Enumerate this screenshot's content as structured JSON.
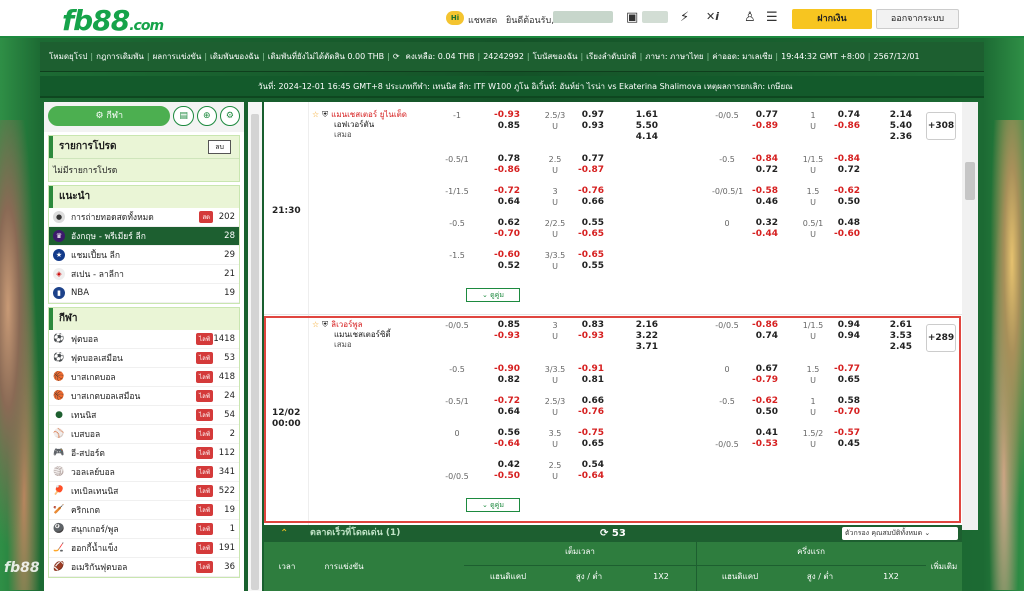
{
  "brand": {
    "name": "fb88",
    "suffix": ".com"
  },
  "topbar": {
    "hi_badge": "Hi",
    "chat": "แชทสด",
    "welcome": "ยินดีต้อนรับ,",
    "deposit": "ฝากเงิน",
    "logout": "ออกจากระบบ",
    "icons": [
      "wallet-icon",
      "flash-icon",
      "sports-x-icon",
      "person-icon",
      "list-icon"
    ]
  },
  "nav": {
    "items": [
      "โหมดยุโรป",
      "กฎการเดิมพัน",
      "ผลการแข่งขัน",
      "เดิมพันของฉัน",
      "เดิมพันที่ยังไม่ได้ตัดสิน 0.00 THB",
      "คงเหลือ: 0.04 THB",
      "24242992",
      "โบนัสของฉัน",
      "เรียงลำดับปกติ",
      "ภาษา: ภาษาไทย",
      "ค่าออด: มาเลเซีย",
      "19:44:32 GMT +8:00",
      "2567/12/01"
    ]
  },
  "ticker": "วันที่: 2024-12-01 16:45 GMT+8 ประเภทกีฬา: เทนนิส ลีก: ITF W100 ภูโน อิเวิ้นท์: อันห์ย่า ไรน่า vs Ekaterina Shalimova เหตุผลการยกเลิก: เกษียณ",
  "sidebar": {
    "sport_button": "กีฬา",
    "fav_title": "รายการโปรด",
    "fav_small": "ลบ",
    "fav_empty": "ไม่มีรายการโปรด",
    "rec_title": "แนะนำ",
    "rec_items": [
      {
        "label": "การถ่ายทอดสดทั้งหมด",
        "count": "202",
        "live": "สด"
      },
      {
        "label": "อังกฤษ - พรีเมียร์ ลีก",
        "count": "28"
      },
      {
        "label": "แชมเปี้ยน ลีก",
        "count": "29"
      },
      {
        "label": "สเปน - ลาลีกา",
        "count": "21"
      },
      {
        "label": "NBA",
        "count": "19"
      }
    ],
    "sports_title": "กีฬา",
    "sports": [
      {
        "label": "ฟุตบอล",
        "count": "1418"
      },
      {
        "label": "ฟุตบอลเสมือน",
        "count": "53"
      },
      {
        "label": "บาสเกตบอล",
        "count": "418"
      },
      {
        "label": "บาสเกตบอลเสมือน",
        "count": "24"
      },
      {
        "label": "เทนนิส",
        "count": "54"
      },
      {
        "label": "เบสบอล",
        "count": "2"
      },
      {
        "label": "อี-สปอร์ต",
        "count": "112"
      },
      {
        "label": "วอลเลย์บอล",
        "count": "341"
      },
      {
        "label": "เทเบิลเทนนิส",
        "count": "522"
      },
      {
        "label": "คริกเกต",
        "count": "19"
      },
      {
        "label": "สนุกเกอร์/พูล",
        "count": "1"
      },
      {
        "label": "ฮอกกี้น้ำแข็ง",
        "count": "191"
      },
      {
        "label": "อเมริกันฟุตบอล",
        "count": "36"
      }
    ],
    "live_tag": "ไลฟ์"
  },
  "match1": {
    "time": "21:30",
    "home": "แมนเชสเตอร์ ยูไนเต็ด",
    "away": "เอฟเวอร์ตัน",
    "draw": "เสมอ",
    "more": "ดูคู่ม",
    "plus": "+308",
    "rows": [
      [
        "-1",
        "-0.93",
        "2.5/3",
        "0.97",
        "1.61",
        "-0/0.5",
        "0.77",
        "1",
        "0.74",
        "2.14"
      ],
      [
        "",
        "0.85",
        "U",
        "0.93",
        "5.50",
        "",
        "-0.89",
        "U",
        "-0.86",
        "5.40"
      ],
      [
        "",
        "",
        "",
        "",
        "4.14",
        "",
        "",
        "",
        "",
        "2.36"
      ],
      [
        "-0.5/1",
        "0.78",
        "2.5",
        "0.77",
        "",
        "-0.5",
        "-0.84",
        "1/1.5",
        "-0.84",
        ""
      ],
      [
        "",
        "-0.86",
        "U",
        "-0.87",
        "",
        "",
        "0.72",
        "U",
        "0.72",
        ""
      ],
      [
        "-1/1.5",
        "-0.72",
        "3",
        "-0.76",
        "",
        "-0/0.5/1",
        "-0.58",
        "1.5",
        "-0.62",
        ""
      ],
      [
        "",
        "0.64",
        "U",
        "0.66",
        "",
        "",
        "0.46",
        "U",
        "0.50",
        ""
      ],
      [
        "-0.5",
        "0.62",
        "2/2.5",
        "0.55",
        "",
        "0",
        "0.32",
        "0.5/1",
        "0.48",
        ""
      ],
      [
        "",
        "-0.70",
        "U",
        "-0.65",
        "",
        "",
        "-0.44",
        "U",
        "-0.60",
        ""
      ],
      [
        "-1.5",
        "-0.60",
        "3/3.5",
        "-0.65",
        "",
        "",
        "",
        "",
        "",
        ""
      ],
      [
        "",
        "0.52",
        "U",
        "0.55",
        "",
        "",
        "",
        "",
        "",
        ""
      ]
    ]
  },
  "match2": {
    "date": "12/02",
    "time": "00:00",
    "home": "ลิเวอร์พูล",
    "away": "แมนเชสเตอร์ซิตี้",
    "draw": "เสมอ",
    "more": "ดูคู่ม",
    "plus": "+289",
    "rows": [
      [
        "-0/0.5",
        "0.85",
        "3",
        "0.83",
        "2.16",
        "-0/0.5",
        "-0.86",
        "1/1.5",
        "0.94",
        "2.61"
      ],
      [
        "",
        "-0.93",
        "U",
        "-0.93",
        "3.22",
        "",
        "0.74",
        "U",
        "0.94",
        "3.53"
      ],
      [
        "",
        "",
        "",
        "",
        "3.71",
        "",
        "",
        "",
        "",
        "2.45"
      ],
      [
        "-0.5",
        "-0.90",
        "3/3.5",
        "-0.91",
        "",
        "0",
        "0.67",
        "1.5",
        "-0.77",
        ""
      ],
      [
        "",
        "0.82",
        "U",
        "0.81",
        "",
        "",
        "-0.79",
        "U",
        "0.65",
        ""
      ],
      [
        "-0.5/1",
        "-0.72",
        "2.5/3",
        "0.66",
        "",
        "-0.5",
        "-0.62",
        "1",
        "0.58",
        ""
      ],
      [
        "",
        "0.64",
        "U",
        "-0.76",
        "",
        "",
        "0.50",
        "U",
        "-0.70",
        ""
      ],
      [
        "0",
        "0.56",
        "3.5",
        "-0.75",
        "",
        "",
        "0.41",
        "1.5/2",
        "-0.57",
        ""
      ],
      [
        "",
        "-0.64",
        "U",
        "0.65",
        "",
        "-0/0.5",
        "-0.53",
        "U",
        "0.45",
        ""
      ],
      [
        "",
        "0.42",
        "2.5",
        "0.54",
        "",
        "",
        "",
        "",
        "",
        ""
      ],
      [
        "-0/0.5",
        "-0.50",
        "U",
        "-0.64",
        "",
        "",
        "",
        "",
        "",
        ""
      ]
    ]
  },
  "bottom": {
    "title": "ตลาดเร็วที่โดดเด่น (1)",
    "count": "53",
    "filter": "ตัวกรอง คุณสมบัติทั้งหมด",
    "col_time": "เวลา",
    "col_comp": "การแข่งขัน",
    "group_full": "เต็มเวลา",
    "group_half": "ครึ่งแรก",
    "col_more": "เพิ่มเติม",
    "sub": [
      "แฮนดิแคป",
      "สูง / ต่ำ",
      "1X2",
      "แฮนดิแคป",
      "สูง / ต่ำ",
      "1X2"
    ]
  }
}
